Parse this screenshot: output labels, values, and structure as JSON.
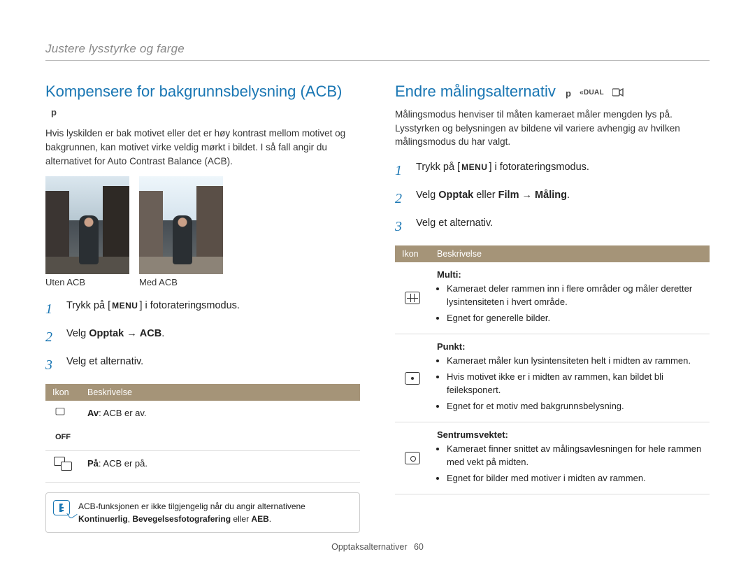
{
  "breadcrumb": "Justere lysstyrke og farge",
  "left": {
    "title": "Kompensere for bakgrunnsbelysning (ACB)",
    "badge_p": "p",
    "intro": "Hvis lyskilden er bak motivet eller det er høy kontrast mellom motivet og bakgrunnen, kan motivet virke veldig mørkt i bildet. I så fall angir du alternativet for Auto Contrast Balance (ACB).",
    "caption_before": "Uten ACB",
    "caption_after": "Med ACB",
    "step1_a": "Trykk på [",
    "step1_menu": "MENU",
    "step1_b": "] i fotorateringsmodus.",
    "step2": "Velg Opptak → ACB.",
    "step3": "Velg et alternativ.",
    "table": {
      "h_icon": "Ikon",
      "h_desc": "Beskrivelse",
      "row_off": "Av: ACB er av.",
      "row_on": "På: ACB er på."
    },
    "note": "ACB-funksjonen er ikke tilgjengelig når du angir alternativene Kontinuerlig, Bevegelsesfotografering eller AEB."
  },
  "right": {
    "title": "Endre målingsalternativ",
    "badge_p": "p",
    "badge_dual": "DUAL",
    "intro": "Målingsmodus henviser til måten kameraet måler mengden lys på. Lysstyrken og belysningen av bildene vil variere avhengig av hvilken målingsmodus du har valgt.",
    "step1_a": "Trykk på [",
    "step1_menu": "MENU",
    "step1_b": "] i fotorateringsmodus.",
    "step2": "Velg Opptak eller Film → Måling.",
    "step3": "Velg et alternativ.",
    "table": {
      "h_icon": "Ikon",
      "h_desc": "Beskrivelse",
      "multi": {
        "label": "Multi:",
        "b1": "Kameraet deler rammen inn i flere områder og måler deretter lysintensiteten i hvert område.",
        "b2": "Egnet for generelle bilder."
      },
      "punkt": {
        "label": "Punkt:",
        "b1": "Kameraet måler kun lysintensiteten helt i midten av rammen.",
        "b2": "Hvis motivet ikke er i midten av rammen, kan bildet bli feileksponert.",
        "b3": "Egnet for et motiv med bakgrunnsbelysning."
      },
      "sentrum": {
        "label": "Sentrumsvektet:",
        "b1": "Kameraet finner snittet av målingsavlesningen for hele rammen med vekt på midten.",
        "b2": "Egnet for bilder med motiver i midten av rammen."
      }
    }
  },
  "footer": {
    "section": "Opptaksalternativer",
    "page": "60"
  }
}
